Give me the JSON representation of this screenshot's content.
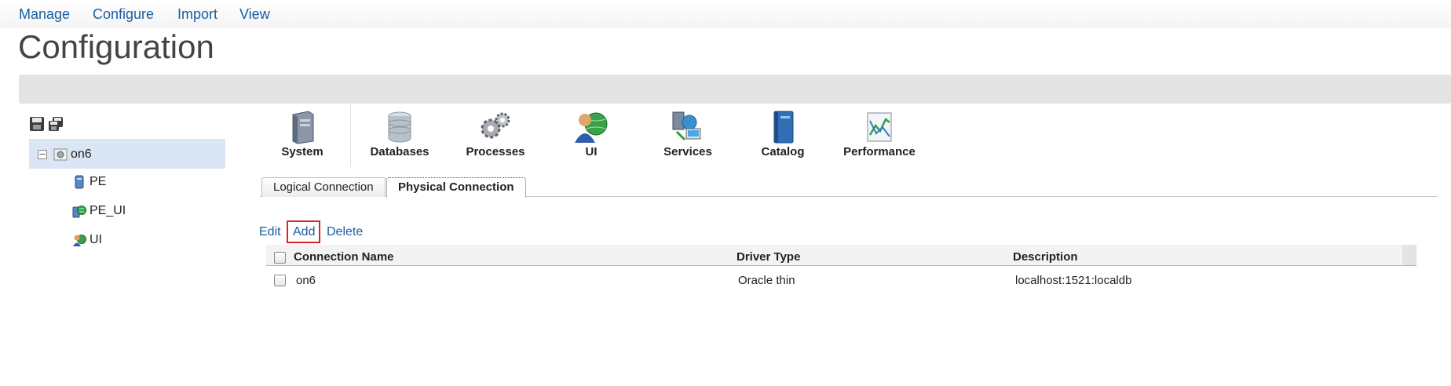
{
  "menu": {
    "items": [
      "Manage",
      "Configure",
      "Import",
      "View"
    ]
  },
  "page": {
    "title": "Configuration"
  },
  "tree": {
    "root_label": "on6",
    "expander_glyph": "−",
    "children": [
      {
        "label": "PE",
        "icon": "database-server-icon"
      },
      {
        "label": "PE_UI",
        "icon": "globe-server-icon"
      },
      {
        "label": "UI",
        "icon": "user-globe-icon"
      }
    ]
  },
  "categories": [
    {
      "label": "System",
      "icon": "server-tower-icon"
    },
    {
      "label": "Databases",
      "icon": "database-icon"
    },
    {
      "label": "Processes",
      "icon": "gears-icon"
    },
    {
      "label": "UI",
      "icon": "user-globe-icon"
    },
    {
      "label": "Services",
      "icon": "network-services-icon"
    },
    {
      "label": "Catalog",
      "icon": "book-icon"
    },
    {
      "label": "Performance",
      "icon": "chart-icon"
    }
  ],
  "tabs": [
    {
      "label": "Logical Connection",
      "active": false
    },
    {
      "label": "Physical Connection",
      "active": true
    }
  ],
  "actions": {
    "edit": "Edit",
    "add": "Add",
    "delete": "Delete"
  },
  "table": {
    "columns": [
      "Connection Name",
      "Driver Type",
      "Description"
    ],
    "rows": [
      {
        "name": "on6",
        "driver": "Oracle thin",
        "description": "localhost:1521:localdb"
      }
    ]
  },
  "colors": {
    "link": "#1a5ea3",
    "highlight": "#d9252a",
    "tree_selected": "#dbe6f5"
  }
}
